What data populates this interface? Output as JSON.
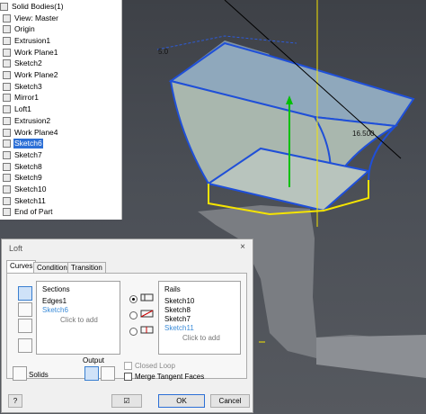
{
  "browser": {
    "items": [
      {
        "label": "Solid Bodies(1)",
        "icon": "solid-bodies-icon"
      },
      {
        "label": "View: Master",
        "icon": "view-icon"
      },
      {
        "label": "Origin",
        "icon": "folder-icon"
      },
      {
        "label": "Extrusion1",
        "icon": "extrusion-icon"
      },
      {
        "label": "Work Plane1",
        "icon": "work-plane-icon"
      },
      {
        "label": "Sketch2",
        "icon": "sketch-icon"
      },
      {
        "label": "Work Plane2",
        "icon": "work-plane-icon"
      },
      {
        "label": "Sketch3",
        "icon": "sketch-icon"
      },
      {
        "label": "Mirror1",
        "icon": "mirror-icon"
      },
      {
        "label": "Loft1",
        "icon": "loft-icon"
      },
      {
        "label": "Extrusion2",
        "icon": "extrusion-icon"
      },
      {
        "label": "Work Plane4",
        "icon": "work-plane-icon"
      },
      {
        "label": "Sketch6",
        "icon": "sketch-icon",
        "selected": true
      },
      {
        "label": "Sketch7",
        "icon": "sketch-icon"
      },
      {
        "label": "Sketch8",
        "icon": "sketch-icon"
      },
      {
        "label": "Sketch9",
        "icon": "sketch-icon"
      },
      {
        "label": "Sketch10",
        "icon": "sketch-icon"
      },
      {
        "label": "Sketch11",
        "icon": "sketch-icon"
      },
      {
        "label": "End of Part",
        "icon": "end-of-part-icon"
      }
    ]
  },
  "viewport": {
    "dimension_left": "5.0",
    "dimension_right": "16.500",
    "accent_highlight": "#1f4fd8",
    "accent_yellow": "#f5e400"
  },
  "loft": {
    "title": "Loft",
    "close": "×",
    "tabs": [
      "Curves",
      "Conditions",
      "Transition"
    ],
    "sections": {
      "header": "Sections",
      "items": [
        "Edges1",
        "Sketch6"
      ],
      "add": "Click to add"
    },
    "rails": {
      "header": "Rails",
      "items": [
        "Sketch10",
        "Sketch8",
        "Sketch7",
        "Sketch11"
      ],
      "add": "Click to add"
    },
    "output_label": "Output",
    "solids_label": "Solids",
    "closed_loop": "Closed Loop",
    "merge_tangent": "Merge Tangent Faces",
    "ok": "OK",
    "cancel": "Cancel",
    "help": "?"
  }
}
